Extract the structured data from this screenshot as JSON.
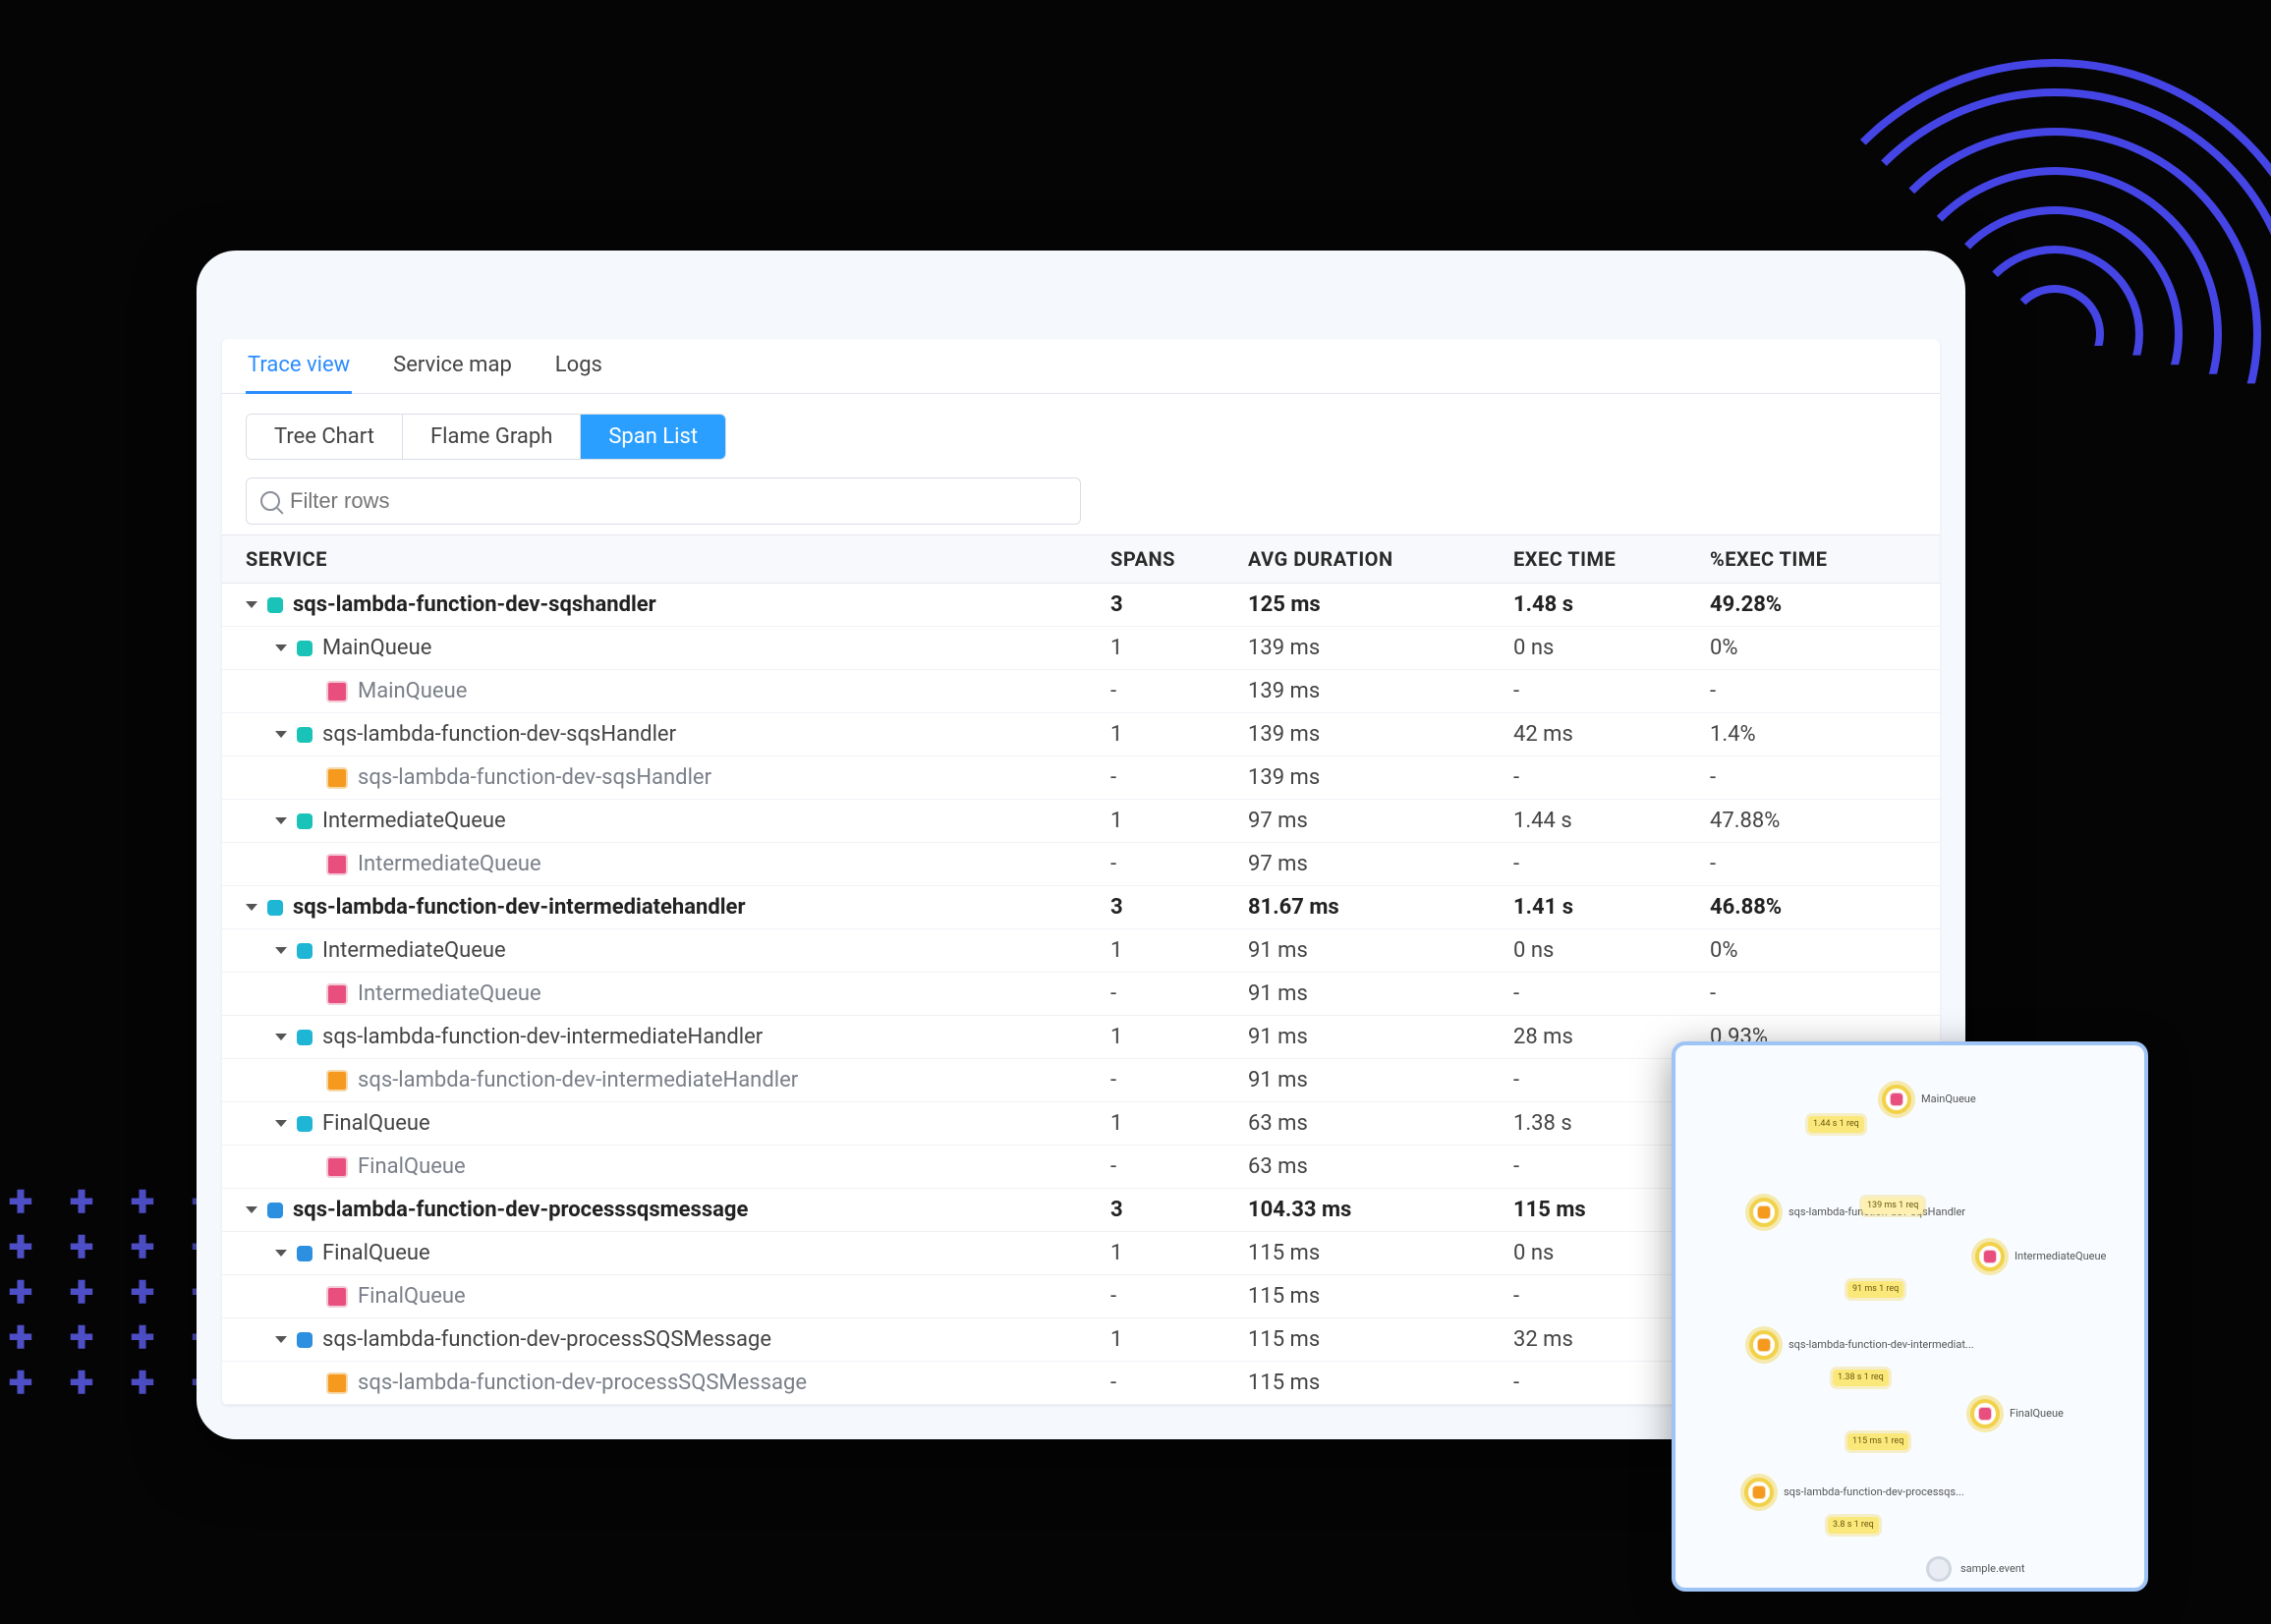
{
  "tabs": [
    {
      "label": "Trace view",
      "active": true
    },
    {
      "label": "Service map",
      "active": false
    },
    {
      "label": "Logs",
      "active": false
    }
  ],
  "subtabs": [
    {
      "label": "Tree Chart",
      "active": false
    },
    {
      "label": "Flame Graph",
      "active": false
    },
    {
      "label": "Span List",
      "active": true
    }
  ],
  "filter": {
    "placeholder": "Filter rows"
  },
  "columns": {
    "service": "SERVICE",
    "spans": "SPANS",
    "avg": "AVG DURATION",
    "exec": "EXEC TIME",
    "pct": "%EXEC TIME"
  },
  "rows": [
    {
      "indent": 0,
      "bold": true,
      "icon": "dot",
      "iconColor": "teal",
      "chev": true,
      "name": "sqs-lambda-function-dev-sqshandler",
      "spans": "3",
      "avg": "125 ms",
      "exec": "1.48 s",
      "pct": "49.28%"
    },
    {
      "indent": 1,
      "bold": false,
      "icon": "dot",
      "iconColor": "teal",
      "chev": true,
      "name": "MainQueue",
      "spans": "1",
      "avg": "139 ms",
      "exec": "0 ns",
      "pct": "0%"
    },
    {
      "indent": 2,
      "bold": false,
      "leaf": true,
      "icon": "sq",
      "iconColor": "pink",
      "chev": false,
      "name": "MainQueue",
      "spans": "-",
      "avg": "139 ms",
      "exec": "-",
      "pct": "-"
    },
    {
      "indent": 1,
      "bold": false,
      "icon": "dot",
      "iconColor": "teal",
      "chev": true,
      "name": "sqs-lambda-function-dev-sqsHandler",
      "spans": "1",
      "avg": "139 ms",
      "exec": "42 ms",
      "pct": "1.4%"
    },
    {
      "indent": 2,
      "bold": false,
      "leaf": true,
      "icon": "sq",
      "iconColor": "orange",
      "chev": false,
      "name": "sqs-lambda-function-dev-sqsHandler",
      "spans": "-",
      "avg": "139 ms",
      "exec": "-",
      "pct": "-"
    },
    {
      "indent": 1,
      "bold": false,
      "icon": "dot",
      "iconColor": "teal",
      "chev": true,
      "name": "IntermediateQueue",
      "spans": "1",
      "avg": "97 ms",
      "exec": "1.44 s",
      "pct": "47.88%"
    },
    {
      "indent": 2,
      "bold": false,
      "leaf": true,
      "icon": "sq",
      "iconColor": "pink",
      "chev": false,
      "name": "IntermediateQueue",
      "spans": "-",
      "avg": "97 ms",
      "exec": "-",
      "pct": "-"
    },
    {
      "indent": 0,
      "bold": true,
      "icon": "dot",
      "iconColor": "cyan",
      "chev": true,
      "name": "sqs-lambda-function-dev-intermediatehandler",
      "spans": "3",
      "avg": "81.67 ms",
      "exec": "1.41 s",
      "pct": "46.88%"
    },
    {
      "indent": 1,
      "bold": false,
      "icon": "dot",
      "iconColor": "cyan",
      "chev": true,
      "name": "IntermediateQueue",
      "spans": "1",
      "avg": "91 ms",
      "exec": "0 ns",
      "pct": "0%"
    },
    {
      "indent": 2,
      "bold": false,
      "leaf": true,
      "icon": "sq",
      "iconColor": "pink",
      "chev": false,
      "name": "IntermediateQueue",
      "spans": "-",
      "avg": "91 ms",
      "exec": "-",
      "pct": "-"
    },
    {
      "indent": 1,
      "bold": false,
      "icon": "dot",
      "iconColor": "cyan",
      "chev": true,
      "name": "sqs-lambda-function-dev-intermediateHandler",
      "spans": "1",
      "avg": "91 ms",
      "exec": "28 ms",
      "pct": "0.93%"
    },
    {
      "indent": 2,
      "bold": false,
      "leaf": true,
      "icon": "sq",
      "iconColor": "orange",
      "chev": false,
      "name": "sqs-lambda-function-dev-intermediateHandler",
      "spans": "-",
      "avg": "91 ms",
      "exec": "-",
      "pct": "-"
    },
    {
      "indent": 1,
      "bold": false,
      "icon": "dot",
      "iconColor": "cyan",
      "chev": true,
      "name": "FinalQueue",
      "spans": "1",
      "avg": "63 ms",
      "exec": "1.38 s",
      "pct": ""
    },
    {
      "indent": 2,
      "bold": false,
      "leaf": true,
      "icon": "sq",
      "iconColor": "pink",
      "chev": false,
      "name": "FinalQueue",
      "spans": "-",
      "avg": "63 ms",
      "exec": "-",
      "pct": "-"
    },
    {
      "indent": 0,
      "bold": true,
      "icon": "dot",
      "iconColor": "blue",
      "chev": true,
      "name": "sqs-lambda-function-dev-processsqsmessage",
      "spans": "3",
      "avg": "104.33 ms",
      "exec": "115 ms",
      "pct": ""
    },
    {
      "indent": 1,
      "bold": false,
      "icon": "dot",
      "iconColor": "blue",
      "chev": true,
      "name": "FinalQueue",
      "spans": "1",
      "avg": "115 ms",
      "exec": "0 ns",
      "pct": ""
    },
    {
      "indent": 2,
      "bold": false,
      "leaf": true,
      "icon": "sq",
      "iconColor": "pink",
      "chev": false,
      "name": "FinalQueue",
      "spans": "-",
      "avg": "115 ms",
      "exec": "-",
      "pct": "-"
    },
    {
      "indent": 1,
      "bold": false,
      "icon": "dot",
      "iconColor": "blue",
      "chev": true,
      "name": "sqs-lambda-function-dev-processSQSMessage",
      "spans": "1",
      "avg": "115 ms",
      "exec": "32 ms",
      "pct": ""
    },
    {
      "indent": 2,
      "bold": false,
      "leaf": true,
      "icon": "sq",
      "iconColor": "orange",
      "chev": false,
      "name": "sqs-lambda-function-dev-processSQSMessage",
      "spans": "-",
      "avg": "115 ms",
      "exec": "-",
      "pct": "-"
    }
  ],
  "minimap": {
    "nodes": [
      {
        "label": "MainQueue"
      },
      {
        "label": "sqs-lambda-function-dev-sqsHandler"
      },
      {
        "label": "IntermediateQueue"
      },
      {
        "label": "sqs-lambda-function-dev-intermediat..."
      },
      {
        "label": "FinalQueue"
      },
      {
        "label": "sqs-lambda-function-dev-processqs..."
      },
      {
        "label": "sample.event"
      }
    ],
    "chips": [
      {
        "text": "1.44 s\n1 req"
      },
      {
        "text": "139 ms\n1 req"
      },
      {
        "text": "91 ms\n1 req"
      },
      {
        "text": "1.38 s\n1 req"
      },
      {
        "text": "115 ms\n1 req"
      },
      {
        "text": "3.8 s\n1 req"
      }
    ]
  }
}
